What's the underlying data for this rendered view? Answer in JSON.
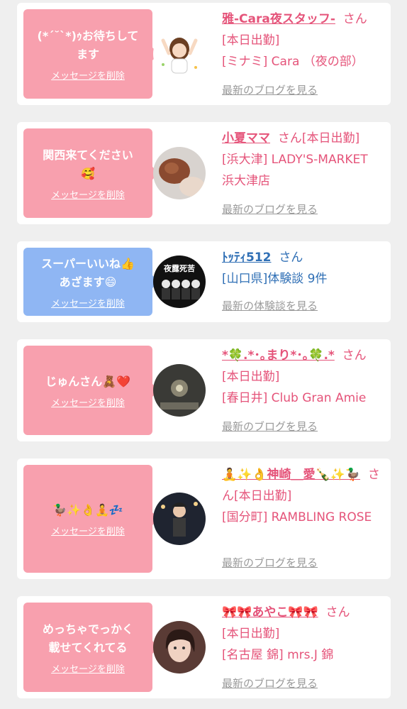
{
  "cards": [
    {
      "message": "(*´˘`*)ｩお待ちして\nます",
      "delete_label": "メッセージを削除",
      "name": "雅-Cara夜スタッフ-",
      "san": "さん",
      "status": "[本日出勤]",
      "detail": "[ミナミ] Cara （夜の部）",
      "link": "最新のブログを見る",
      "avatar_icon": "illustrated-girl-avatar",
      "bubble_color": "#f8a0ae"
    },
    {
      "message": "関西来てください\n🥰",
      "delete_label": "メッセージを削除",
      "name": "小夏ママ",
      "san": "さん",
      "status": "[本日出勤]",
      "detail": "[浜大津] LADY'S-MARKET 浜大津店",
      "link": "最新のブログを見る",
      "avatar_icon": "hair-photo-avatar",
      "bubble_color": "#f8a0ae"
    },
    {
      "message": "スーパーいいね👍\nあざます😄",
      "delete_label": "メッセージを削除",
      "name": "ﾄｯﾃｨ512",
      "san": "さん",
      "status": "",
      "detail": "[山口県]体験談 9件",
      "link": "最新の体験談を見る",
      "avatar_icon": "group-photo-avatar",
      "avatar_text": "夜露死苦",
      "bubble_color": "#8fb6f3"
    },
    {
      "message": "じゅんさん🧸❤️",
      "delete_label": "メッセージを削除",
      "name": "*🍀.*･｡まり*･｡🍀.*",
      "san": "さん",
      "status": "[本日出勤]",
      "detail": "[春日井] Club Gran Amie",
      "link": "最新のブログを見る",
      "avatar_icon": "chandelier-photo-avatar",
      "bubble_color": "#f8a0ae"
    },
    {
      "message": "🦆✨👌🧘💤",
      "delete_label": "メッセージを削除",
      "name": "🧘✨👌神崎＿愛🍾✨🦆",
      "san": "さん",
      "status": "[本日出勤]",
      "detail": "[国分町] RAMBLING ROSE",
      "link": "最新のブログを見る",
      "avatar_icon": "night-photo-avatar",
      "bubble_color": "#f8a0ae"
    },
    {
      "message": "めっちゃでっかく\n載せてくれてる",
      "delete_label": "メッセージを削除",
      "name": "🎀🎀あやこ🎀🎀",
      "san": "さん",
      "status": "[本日出勤]",
      "detail": "[名古屋 錦] mrs.J 錦",
      "link": "最新のブログを見る",
      "avatar_icon": "selfie-photo-avatar",
      "bubble_color": "#f8a0ae"
    }
  ]
}
